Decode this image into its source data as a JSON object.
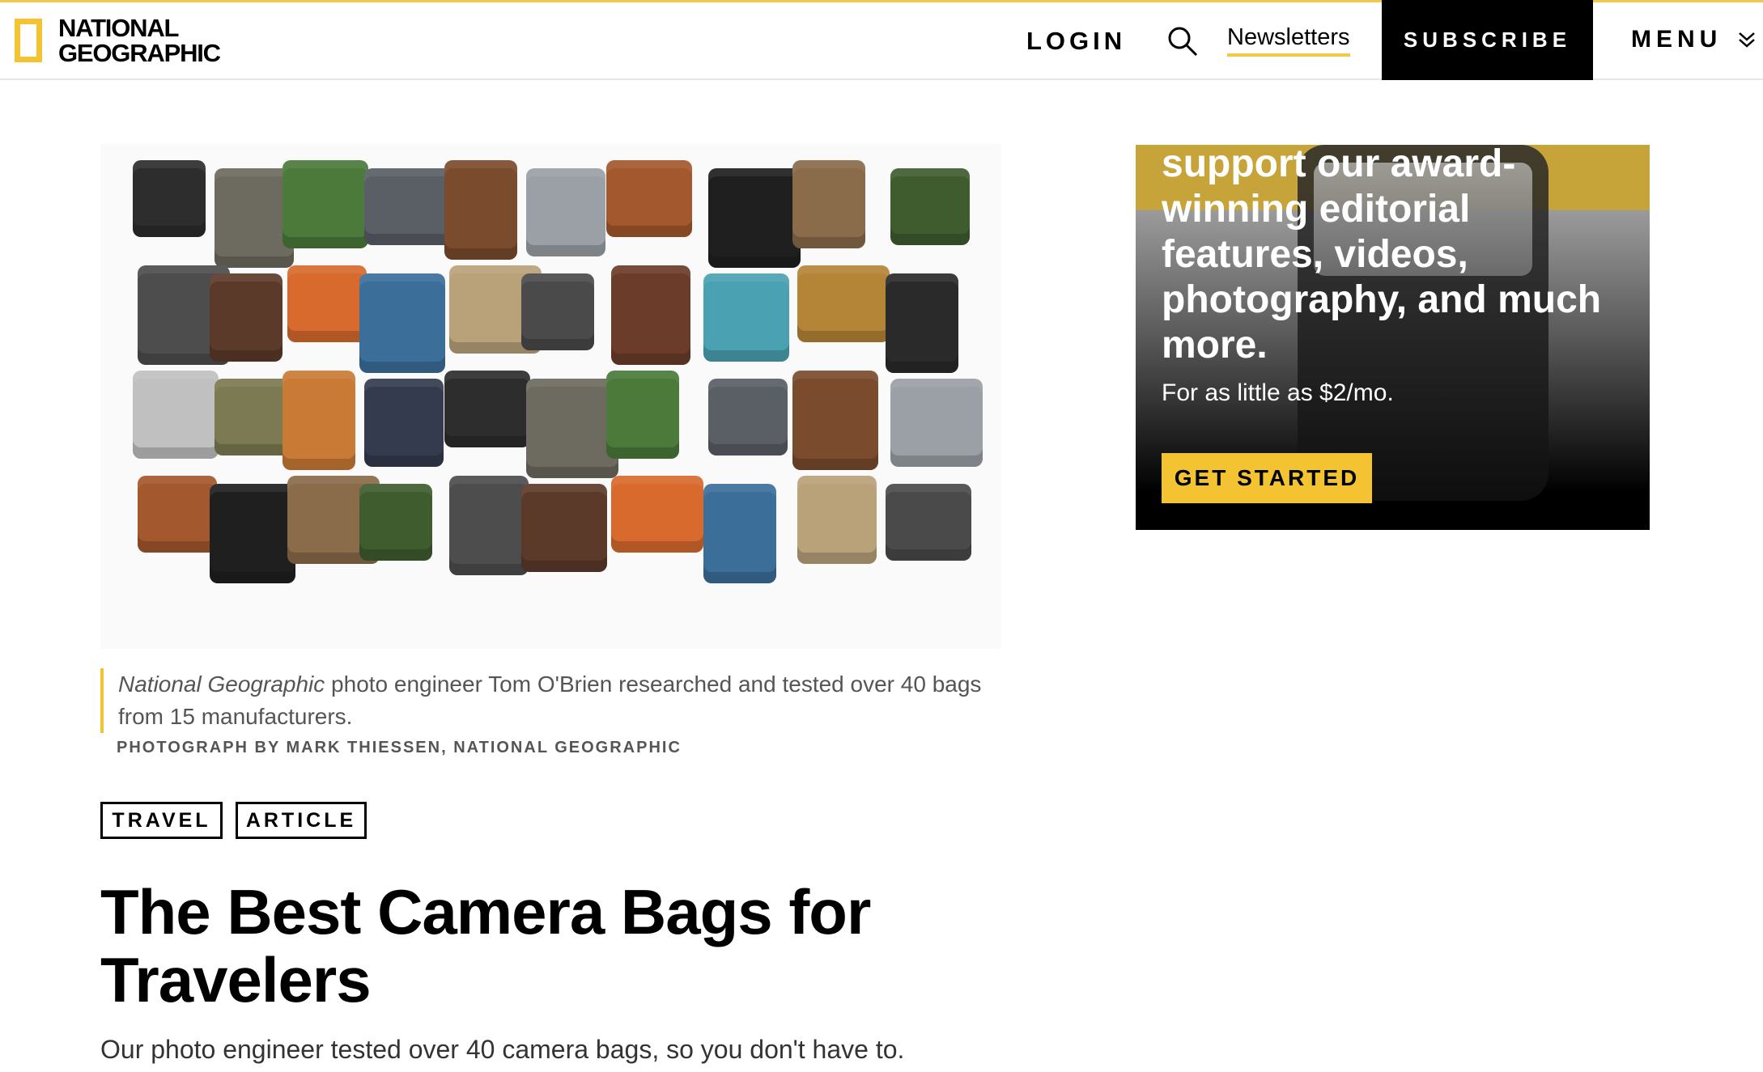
{
  "header": {
    "logo_line1": "NATIONAL",
    "logo_line2": "GEOGRAPHIC",
    "login": "LOGIN",
    "newsletters": "Newsletters",
    "subscribe": "SUBSCRIBE",
    "menu": "MENU",
    "accent_color": "#f2c84b"
  },
  "hero": {
    "alt": "Grid of over 40 camera bags and backpacks"
  },
  "caption": {
    "italic": "National Geographic",
    "text": " photo engineer Tom O'Brien researched and tested over 40 bags from 15 manufacturers.",
    "credit": "PHOTOGRAPH BY MARK THIESSEN, NATIONAL GEOGRAPHIC"
  },
  "tags": [
    "TRAVEL",
    "ARTICLE"
  ],
  "article": {
    "title": "The Best Camera Bags for Travelers",
    "dek": "Our photo engineer tested over 40 camera bags, so you don't have to."
  },
  "ad": {
    "headline": "support our award-winning editorial features, videos, photography, and much more.",
    "sub": "For as little as $2/mo.",
    "cta": "GET STARTED"
  }
}
